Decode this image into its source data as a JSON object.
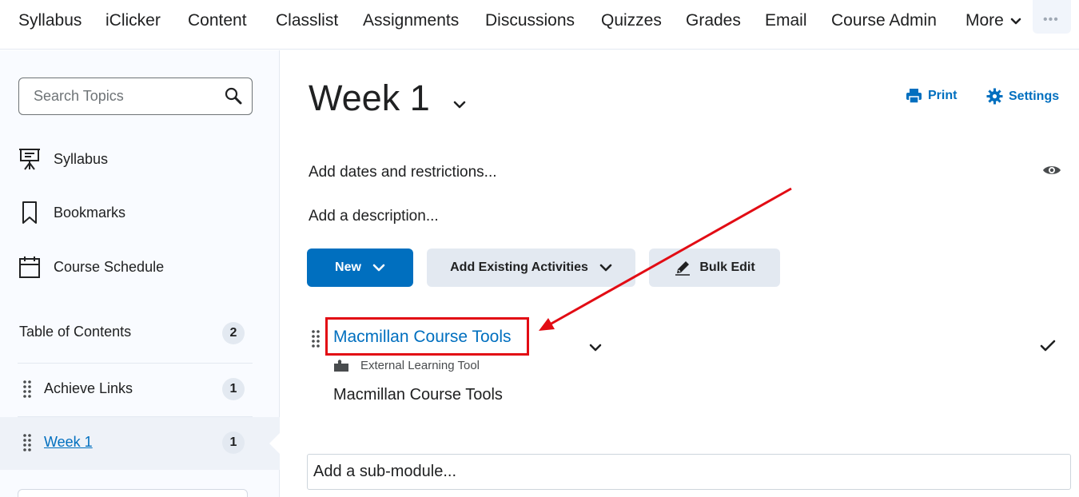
{
  "nav": {
    "items": [
      "Syllabus",
      "iClicker",
      "Content",
      "Classlist",
      "Assignments",
      "Discussions",
      "Quizzes",
      "Grades",
      "Email",
      "Course Admin"
    ],
    "more_label": "More",
    "overflow_icon": "more-dots-icon"
  },
  "sidebar": {
    "search": {
      "placeholder": "Search Topics",
      "icon": "search-icon"
    },
    "links": [
      {
        "label": "Syllabus",
        "icon": "presentation-easel-icon"
      },
      {
        "label": "Bookmarks",
        "icon": "bookmark-icon"
      },
      {
        "label": "Course Schedule",
        "icon": "calendar-icon"
      }
    ],
    "toc": {
      "label": "Table of Contents",
      "count": "2",
      "modules": [
        {
          "label": "Achieve Links",
          "count": "1",
          "active": false
        },
        {
          "label": "Week 1",
          "count": "1",
          "active": true
        }
      ]
    }
  },
  "main": {
    "title": "Week 1",
    "print_label": "Print",
    "settings_label": "Settings",
    "dates_label": "Add dates and restrictions...",
    "description_label": "Add a description...",
    "buttons": {
      "new_label": "New",
      "add_existing_label": "Add Existing Activities",
      "bulk_edit_label": "Bulk Edit"
    },
    "item": {
      "title": "Macmillan Course Tools",
      "type": "External Learning Tool",
      "description": "Macmillan Course Tools"
    },
    "submodule_label": "Add a sub-module..."
  },
  "colors": {
    "accent": "#006fbf",
    "annotation_red": "#e20c14",
    "button_gray": "#e3e9f1"
  }
}
